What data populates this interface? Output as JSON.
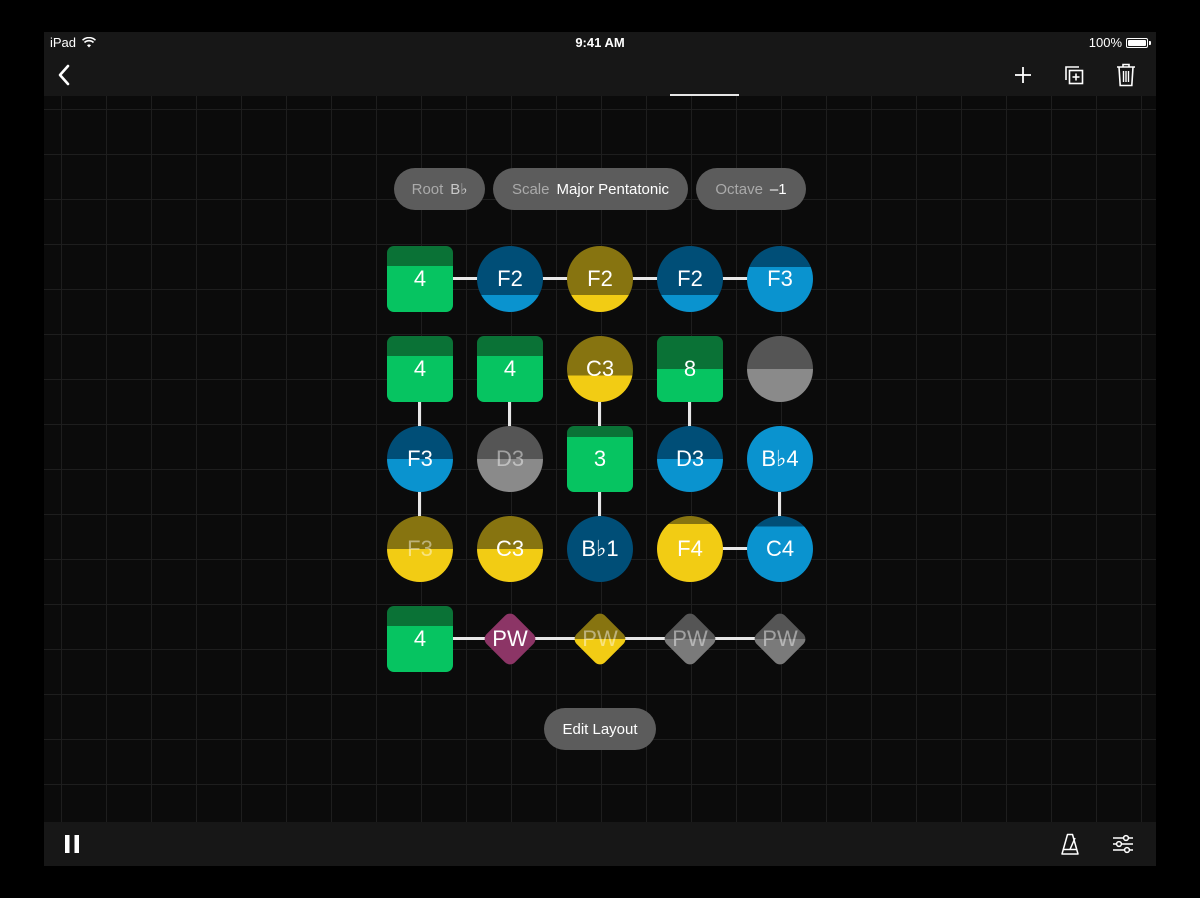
{
  "status_bar": {
    "device": "iPad",
    "time": "9:41 AM",
    "battery": "100%"
  },
  "toolbar": {
    "back_icon": "chevron-left-icon",
    "add_icon": "plus-icon",
    "duplicate_icon": "duplicate-icon",
    "delete_icon": "trash-icon"
  },
  "settings": {
    "root": {
      "label": "Root",
      "value": "B♭"
    },
    "scale": {
      "label": "Scale",
      "value": "Major Pentatonic"
    },
    "octave": {
      "label": "Octave",
      "value": "–1"
    }
  },
  "grid": {
    "rows": [
      [
        {
          "shape": "square",
          "label": "4",
          "style": "green"
        },
        {
          "shape": "circle",
          "label": "F2",
          "style": "blue-dark"
        },
        {
          "shape": "circle",
          "label": "F2",
          "style": "olive"
        },
        {
          "shape": "circle",
          "label": "F2",
          "style": "blue-dark"
        },
        {
          "shape": "circle",
          "label": "F3",
          "style": "blue-half"
        }
      ],
      [
        {
          "shape": "square",
          "label": "4",
          "style": "green"
        },
        {
          "shape": "square",
          "label": "4",
          "style": "green"
        },
        {
          "shape": "circle",
          "label": "C3",
          "style": "yellow-half"
        },
        {
          "shape": "square",
          "label": "8",
          "style": "green-half"
        },
        {
          "shape": "circle",
          "label": "",
          "style": "gray-half"
        }
      ],
      [
        {
          "shape": "circle",
          "label": "F3",
          "style": "blue-half"
        },
        {
          "shape": "circle",
          "label": "D3",
          "style": "gray-half",
          "faded": true
        },
        {
          "shape": "square",
          "label": "3",
          "style": "green-thin"
        },
        {
          "shape": "circle",
          "label": "D3",
          "style": "blue-half"
        },
        {
          "shape": "circle",
          "label": "B♭4",
          "style": "blue-full"
        }
      ],
      [
        {
          "shape": "circle",
          "label": "F3",
          "style": "yellow-half",
          "faded": true
        },
        {
          "shape": "circle",
          "label": "C3",
          "style": "yellow-half"
        },
        {
          "shape": "circle",
          "label": "B♭1",
          "style": "blue-dark-full"
        },
        {
          "shape": "circle",
          "label": "F4",
          "style": "yellow-mostly"
        },
        {
          "shape": "circle",
          "label": "C4",
          "style": "blue-mostly"
        }
      ],
      [
        {
          "shape": "square",
          "label": "4",
          "style": "green"
        },
        {
          "shape": "diamond",
          "label": "PW",
          "style": "magenta"
        },
        {
          "shape": "diamond",
          "label": "PW",
          "style": "yellow-diamond",
          "faded": true
        },
        {
          "shape": "diamond",
          "label": "PW",
          "style": "gray-diamond",
          "faded": true
        },
        {
          "shape": "diamond",
          "label": "PW",
          "style": "gray-diamond",
          "faded": true
        }
      ]
    ]
  },
  "edit_layout_label": "Edit Layout",
  "bottom_bar": {
    "pause_icon": "pause-icon",
    "metronome_icon": "metronome-icon",
    "mixer_icon": "sliders-icon"
  }
}
